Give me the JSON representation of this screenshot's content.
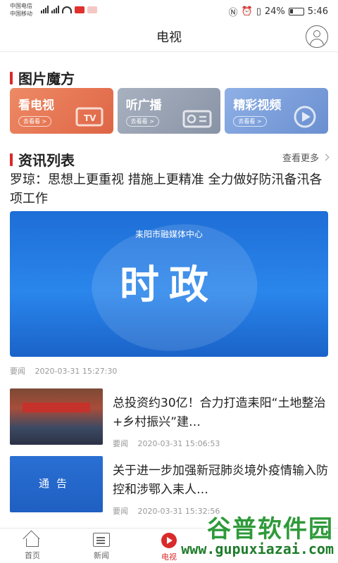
{
  "status_bar": {
    "carrier1": "中国电信",
    "carrier2": "中国移动",
    "battery": "24%",
    "time": "5:46"
  },
  "header": {
    "title": "电视"
  },
  "cube": {
    "title": "图片魔方",
    "cards": [
      {
        "label": "看电视",
        "sub": "去看看 >",
        "color": "#e8795a",
        "icon": "tv-icon"
      },
      {
        "label": "听广播",
        "sub": "去看看 >",
        "color": "#9aa4b4",
        "icon": "radio-icon"
      },
      {
        "label": "精彩视频",
        "sub": "去看看 >",
        "color": "#7f9fd8",
        "icon": "video-icon"
      }
    ]
  },
  "news": {
    "title": "资讯列表",
    "more": "查看更多",
    "featured": {
      "headline": "罗琼：思想上更重视 措施上更精准 全力做好防汛备汛各项工作",
      "image_subtitle": "耒阳市融媒体中心",
      "image_title": "时政",
      "tag": "要闻",
      "time": "2020-03-31 15:27:30"
    },
    "items": [
      {
        "title": "总投资约30亿！合力打造耒阳“土地整治+乡村振兴”建…",
        "tag": "要闻",
        "time": "2020-03-31 15:06:53"
      },
      {
        "title": "关于进一步加强新冠肺炎境外疫情输入防控和涉鄂入耒人…",
        "tag": "要闻",
        "time": "2020-03-31 15:32:56",
        "thumb_label": "通告"
      }
    ]
  },
  "tabs": [
    {
      "label": "首页",
      "icon": "home-icon",
      "active": false
    },
    {
      "label": "新闻",
      "icon": "news-icon",
      "active": false
    },
    {
      "label": "电视",
      "icon": "tv-play-icon",
      "active": true
    }
  ],
  "watermark": {
    "line1": "谷普软件园",
    "line2": "www.gupuxiazai.com"
  }
}
